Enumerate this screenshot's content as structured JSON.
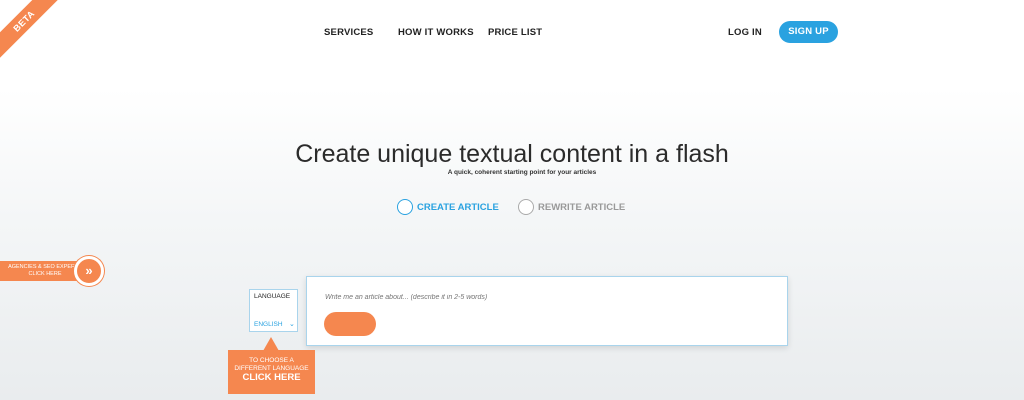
{
  "beta_label": "BETA",
  "nav": {
    "services": "SERVICES",
    "how_it_works": "HOW IT WORKS",
    "price_list": "PRICE LIST",
    "login": "LOG IN",
    "signup": "SIGN UP"
  },
  "hero": {
    "title": "Create unique textual content in a flash",
    "subtitle": "A quick, coherent starting point for your articles"
  },
  "modes": [
    {
      "label": "CREATE ARTICLE",
      "selected": true
    },
    {
      "label": "REWRITE ARTICLE",
      "selected": false
    }
  ],
  "agency": {
    "line1": "AGENCIES & SEO EXPERTS",
    "line2": "CLICK HERE",
    "arrow": "»"
  },
  "language": {
    "label": "LANGUAGE",
    "value": "ENGLISH"
  },
  "article_input": {
    "placeholder": "Write me an article about... (describe it in 2-5 words)",
    "value": ""
  },
  "tooltip": {
    "line1": "TO CHOOSE A",
    "line2": "DIFFERENT LANGUAGE",
    "cta": "CLICK HERE"
  },
  "colors": {
    "accent": "#2aa2e0",
    "orange": "#f5874f"
  }
}
